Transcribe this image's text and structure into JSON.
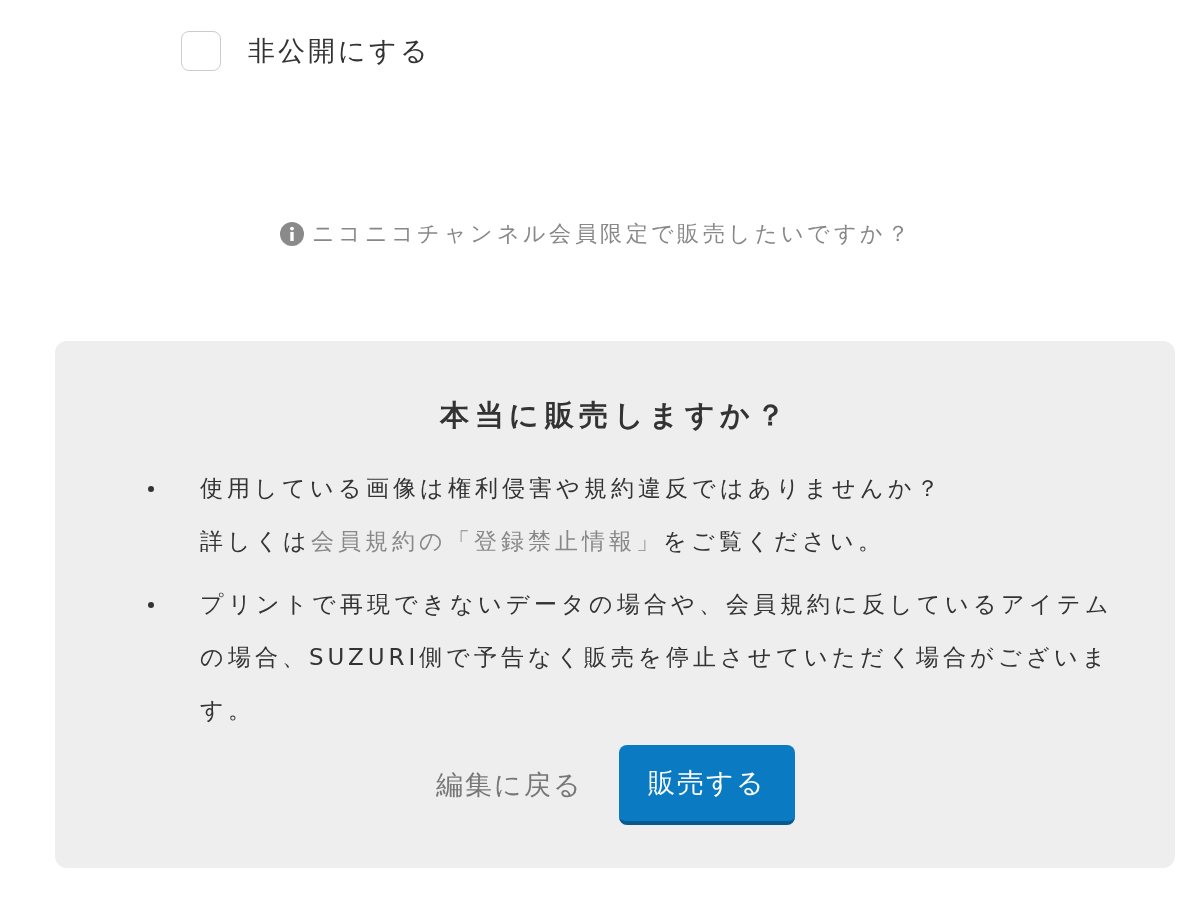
{
  "visibility_option": {
    "label": "非公開にする",
    "checked": false
  },
  "channel_notice": {
    "text": "ニコニコチャンネル会員限定で販売したいですか？"
  },
  "confirm_dialog": {
    "title": "本当に販売しますか？",
    "notes": [
      {
        "lines": [
          [
            {
              "kind": "text",
              "text": "使用している画像は権利侵害や規約違反ではありませんか？"
            }
          ],
          [
            {
              "kind": "text",
              "text": "詳しくは"
            },
            {
              "kind": "link",
              "text": "会員規約の「登録禁止情報」"
            },
            {
              "kind": "text",
              "text": "をご覧ください。"
            }
          ]
        ]
      },
      {
        "lines": [
          [
            {
              "kind": "text",
              "text": "プリントで再現できないデータの場合や、会員規約に反しているアイテムの場合、SUZURI側で予告なく販売を停止させていただく場合がございます。"
            }
          ]
        ]
      }
    ],
    "back_link": "編集に戻る",
    "submit_button": "販売する"
  }
}
